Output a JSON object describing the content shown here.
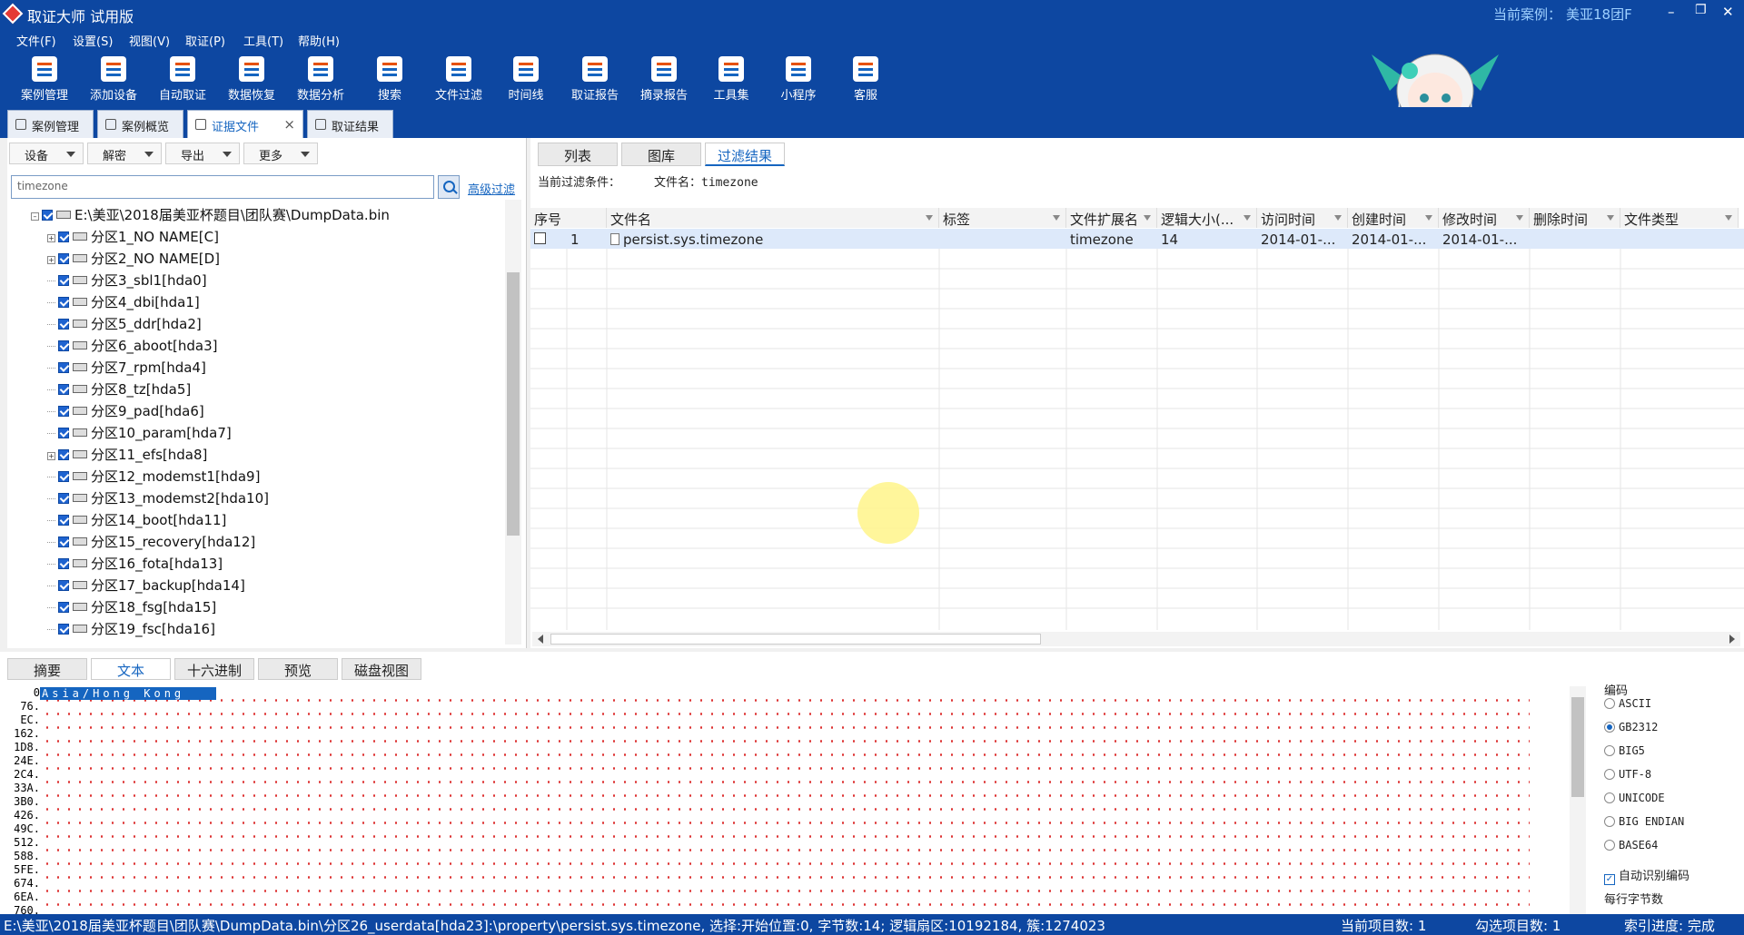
{
  "window": {
    "title": "取证大师 试用版",
    "current_case_label": "当前案例：",
    "current_case": "美亚18团F",
    "controls": [
      "–",
      "❐",
      "✕"
    ]
  },
  "menu": [
    "文件(F)",
    "设置(S)",
    "视图(V)",
    "取证(P)",
    "工具(T)",
    "帮助(H)"
  ],
  "toolbar": [
    "案例管理",
    "添加设备",
    "自动取证",
    "数据恢复",
    "数据分析",
    "搜索",
    "文件过滤",
    "时间线",
    "取证报告",
    "摘录报告",
    "工具集",
    "小程序",
    "客服"
  ],
  "tabs": [
    {
      "label": "案例管理",
      "icon": "edit-icon"
    },
    {
      "label": "案例概览",
      "icon": "gauge-icon"
    },
    {
      "label": "证据文件",
      "icon": "folder-icon",
      "active": true,
      "closable": true
    },
    {
      "label": "取证结果",
      "icon": "document-icon"
    }
  ],
  "left": {
    "buttons": [
      "设备",
      "解密",
      "导出",
      "更多"
    ],
    "search_value": "timezone",
    "advanced_filter": "高级过滤",
    "tree": [
      {
        "label": "E:\\美亚\\2018届美亚杯题目\\团队赛\\DumpData.bin",
        "level": 0,
        "expander": "⊟"
      },
      {
        "label": "分区1_NO NAME[C]",
        "level": 1,
        "expander": "+"
      },
      {
        "label": "分区2_NO NAME[D]",
        "level": 1,
        "expander": "+"
      },
      {
        "label": "分区3_sbl1[hda0]",
        "level": 1
      },
      {
        "label": "分区4_dbi[hda1]",
        "level": 1
      },
      {
        "label": "分区5_ddr[hda2]",
        "level": 1
      },
      {
        "label": "分区6_aboot[hda3]",
        "level": 1
      },
      {
        "label": "分区7_rpm[hda4]",
        "level": 1
      },
      {
        "label": "分区8_tz[hda5]",
        "level": 1
      },
      {
        "label": "分区9_pad[hda6]",
        "level": 1
      },
      {
        "label": "分区10_param[hda7]",
        "level": 1
      },
      {
        "label": "分区11_efs[hda8]",
        "level": 1,
        "expander": "+"
      },
      {
        "label": "分区12_modemst1[hda9]",
        "level": 1
      },
      {
        "label": "分区13_modemst2[hda10]",
        "level": 1
      },
      {
        "label": "分区14_boot[hda11]",
        "level": 1
      },
      {
        "label": "分区15_recovery[hda12]",
        "level": 1
      },
      {
        "label": "分区16_fota[hda13]",
        "level": 1
      },
      {
        "label": "分区17_backup[hda14]",
        "level": 1
      },
      {
        "label": "分区18_fsg[hda15]",
        "level": 1
      },
      {
        "label": "分区19_fsc[hda16]",
        "level": 1
      }
    ]
  },
  "right": {
    "tabs": [
      "列表",
      "图库",
      "过滤结果"
    ],
    "active_tab": 2,
    "filter_label": "当前过滤条件：",
    "filter_value": "文件名：timezone",
    "columns": [
      "序号",
      "文件名",
      "标签",
      "文件扩展名",
      "逻辑大小(...",
      "访问时间",
      "创建时间",
      "修改时间",
      "删除时间",
      "文件类型"
    ],
    "rows": [
      {
        "index": "1",
        "name": "persist.sys.timezone",
        "tag": "",
        "ext": "timezone",
        "size": "14",
        "atime": "2014-01-...",
        "ctime": "2014-01-...",
        "mtime": "2014-01-...",
        "dtime": "",
        "type": ""
      }
    ]
  },
  "bottom": {
    "tabs": [
      "摘要",
      "文本",
      "十六进制",
      "预览",
      "磁盘视图"
    ],
    "active_tab": 1,
    "offsets": [
      "0",
      "76.",
      "EC.",
      "162.",
      "1D8.",
      "24E.",
      "2C4.",
      "33A.",
      "3B0.",
      "426.",
      "49C.",
      "512.",
      "588.",
      "5FE.",
      "674.",
      "6EA.",
      "760."
    ],
    "text_selected": "Asia/Hong Kong",
    "encoding_title": "编码",
    "encodings": [
      "ASCII",
      "GB2312",
      "BIG5",
      "UTF-8",
      "UNICODE",
      "BIG ENDIAN",
      "BASE64"
    ],
    "selected_encoding": "GB2312",
    "auto_detect": "自动识别编码",
    "bytes_per_row": "每行字节数"
  },
  "status": {
    "path": "E:\\美亚\\2018届美亚杯题目\\团队赛\\DumpData.bin\\分区26_userdata[hda23]:\\property\\persist.sys.timezone, 选择:开始位置:0, 字节数:14; 逻辑扇区:10192184, 簇:1274023",
    "current_items": "当前项目数: 1",
    "checked_items": "勾选项目数: 1",
    "index_progress": "索引进度: 完成"
  },
  "colors": {
    "brand_blue": "#0d47a1",
    "accent": "#1565c0",
    "row_highlight": "#dde9fa"
  }
}
